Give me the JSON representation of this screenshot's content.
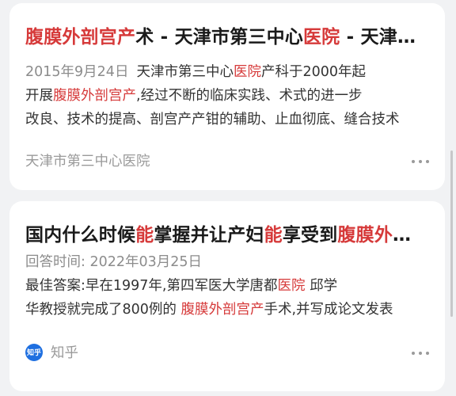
{
  "results": [
    {
      "title_parts": [
        {
          "text": "腹膜外剖宫产",
          "hl": true
        },
        {
          "text": "术 - 天津市第三中心",
          "hl": false
        },
        {
          "text": "医院",
          "hl": true
        },
        {
          "text": " - 天津市第三中心医院官网",
          "hl": false
        }
      ],
      "date": "2015年9月24日",
      "snippet_line1": [
        {
          "text": "天津市第三中心",
          "hl": false
        },
        {
          "text": "医院",
          "hl": true
        },
        {
          "text": "产科于2000年起",
          "hl": false
        }
      ],
      "snippet_line2": [
        {
          "text": "开展",
          "hl": false
        },
        {
          "text": "腹膜外剖宫产",
          "hl": true
        },
        {
          "text": ",经过不断的临床实践、术式的进一步",
          "hl": false
        }
      ],
      "snippet_line3": [
        {
          "text": "改良、技术的提高、剖宫产产钳的辅助、止血彻底、缝合技术",
          "hl": false
        }
      ],
      "source": "天津市第三中心医院"
    },
    {
      "title_parts": [
        {
          "text": "国内什么时候",
          "hl": false
        },
        {
          "text": "能",
          "hl": true
        },
        {
          "text": "掌握并让产妇",
          "hl": false
        },
        {
          "text": "能",
          "hl": true
        },
        {
          "text": "享受到",
          "hl": false
        },
        {
          "text": "腹膜外剖宫产",
          "hl": true
        }
      ],
      "meta": "回答时间: 2022年03月25日",
      "snippet_line1": [
        {
          "text": "最佳答案:早在1997年,第四军医大学唐都",
          "hl": false
        },
        {
          "text": "医院",
          "hl": true
        },
        {
          "text": " 邱学",
          "hl": false
        }
      ],
      "snippet_line2": [
        {
          "text": "华教授就完成了800例的 ",
          "hl": false
        },
        {
          "text": "腹膜外剖宫产",
          "hl": true
        },
        {
          "text": "手术,并写成论文发表",
          "hl": false
        }
      ],
      "source_logo": "知乎",
      "source": "知乎"
    }
  ],
  "colors": {
    "highlight": "#d63a3a",
    "zhihu_blue": "#1e6fe0",
    "background": "#f1f2f4"
  },
  "icons": {
    "more": "more-dots-icon",
    "zhihu": "zhihu-logo-icon"
  }
}
